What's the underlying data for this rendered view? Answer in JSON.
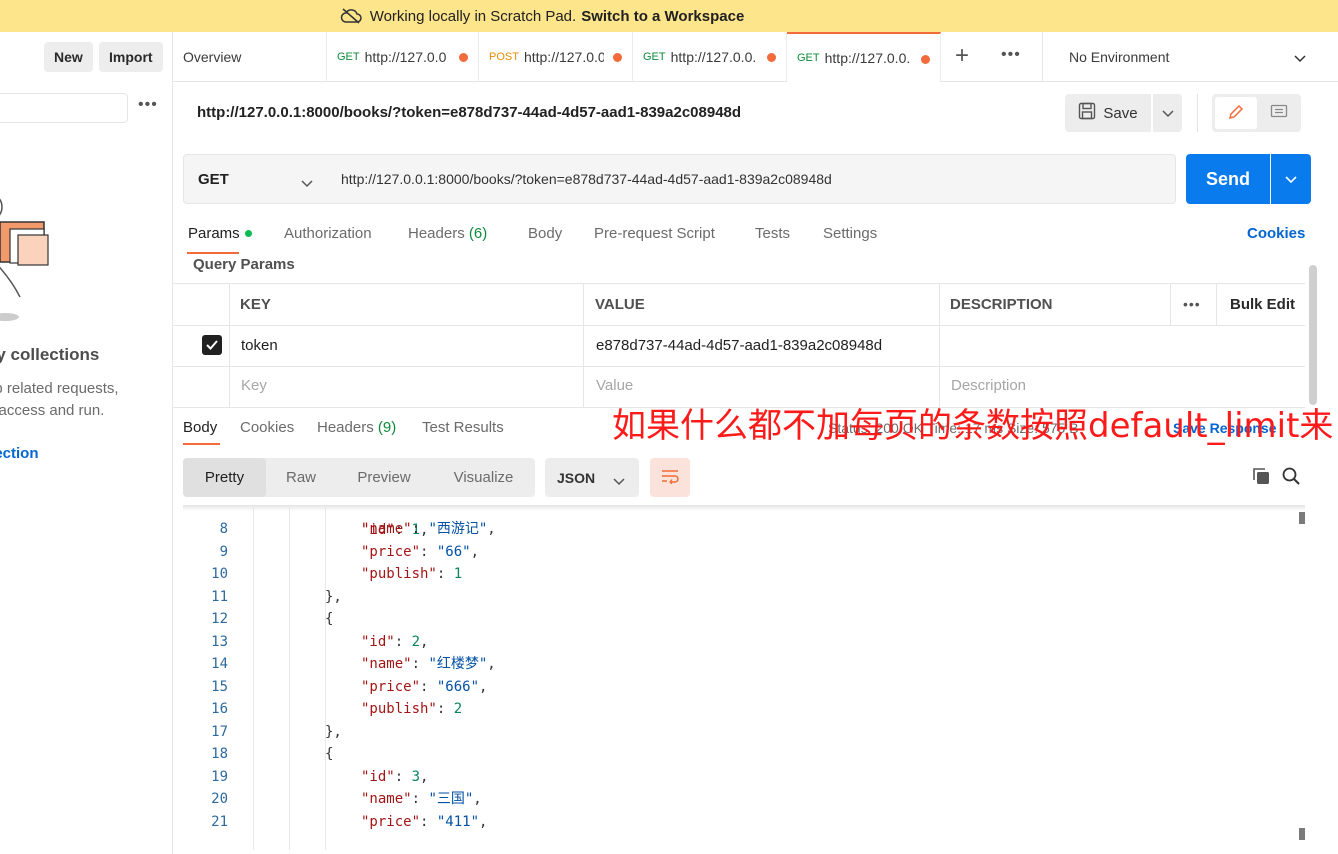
{
  "banner": {
    "text": "Working locally in Scratch Pad.",
    "link": "Switch to a Workspace"
  },
  "sidebar": {
    "new_label": "New",
    "import_label": "Import",
    "empty_title": "ny collections",
    "empty_line1": "up related requests,",
    "empty_line2": "o access and run.",
    "create_link": "llection"
  },
  "tabs": [
    {
      "label": "Overview"
    },
    {
      "method": "GET",
      "label": "http://127.0.0"
    },
    {
      "method": "POST",
      "label": "http://127.0.0"
    },
    {
      "method": "GET",
      "label": "http://127.0.0."
    },
    {
      "method": "GET",
      "label": "http://127.0.0."
    }
  ],
  "environment": {
    "label": "No Environment"
  },
  "request": {
    "title": "http://127.0.0.1:8000/books/?token=e878d737-44ad-4d57-aad1-839a2c08948d",
    "save_label": "Save",
    "method": "GET",
    "url": "http://127.0.0.1:8000/books/?token=e878d737-44ad-4d57-aad1-839a2c08948d",
    "send_label": "Send"
  },
  "req_tabs": {
    "params": "Params",
    "authorization": "Authorization",
    "headers": "Headers",
    "headers_count": "(6)",
    "body": "Body",
    "prerequest": "Pre-request Script",
    "tests": "Tests",
    "settings": "Settings",
    "cookies": "Cookies"
  },
  "query_params": {
    "label": "Query Params",
    "columns": [
      "KEY",
      "VALUE",
      "DESCRIPTION"
    ],
    "bulk_edit": "Bulk Edit",
    "rows": [
      {
        "key": "token",
        "value": "e878d737-44ad-4d57-aad1-839a2c08948d",
        "description": "",
        "checked": true
      }
    ],
    "placeholders": {
      "key": "Key",
      "value": "Value",
      "description": "Description"
    }
  },
  "response": {
    "tabs": {
      "body": "Body",
      "cookies": "Cookies",
      "headers": "Headers",
      "headers_count": "(9)",
      "test_results": "Test Results"
    },
    "status_line": "Status: 200 OK   Time: 17 ms   Size: 575 B",
    "save_response": "Save Response",
    "view_modes": [
      "Pretty",
      "Raw",
      "Preview",
      "Visualize"
    ],
    "format": "JSON"
  },
  "annotation": "如果什么都不加每页的条数按照default_limit来",
  "code_lines": [
    {
      "n": "8",
      "indent": 1,
      "key": "name",
      "val": "西游记",
      "type": "str",
      "comma": true
    },
    {
      "n": "9",
      "indent": 1,
      "key": "price",
      "val": "66",
      "type": "str",
      "comma": true
    },
    {
      "n": "10",
      "indent": 1,
      "key": "publish",
      "val": "1",
      "type": "num",
      "comma": false
    },
    {
      "n": "11",
      "indent": 0,
      "text": "},"
    },
    {
      "n": "12",
      "indent": 0,
      "text": "{"
    },
    {
      "n": "13",
      "indent": 1,
      "key": "id",
      "val": "2",
      "type": "num",
      "comma": true
    },
    {
      "n": "14",
      "indent": 1,
      "key": "name",
      "val": "红楼梦",
      "type": "str",
      "comma": true
    },
    {
      "n": "15",
      "indent": 1,
      "key": "price",
      "val": "666",
      "type": "str",
      "comma": true
    },
    {
      "n": "16",
      "indent": 1,
      "key": "publish",
      "val": "2",
      "type": "num",
      "comma": false
    },
    {
      "n": "17",
      "indent": 0,
      "text": "},"
    },
    {
      "n": "18",
      "indent": 0,
      "text": "{"
    },
    {
      "n": "19",
      "indent": 1,
      "key": "id",
      "val": "3",
      "type": "num",
      "comma": true
    },
    {
      "n": "20",
      "indent": 1,
      "key": "name",
      "val": "三国",
      "type": "str",
      "comma": true
    },
    {
      "n": "21",
      "indent": 1,
      "key": "price",
      "val": "411",
      "type": "str",
      "comma": true
    }
  ],
  "colors": {
    "accent": "#f26b3a",
    "send": "#097bed",
    "banner": "#fde58b",
    "annotation": "#ff1a1a"
  }
}
